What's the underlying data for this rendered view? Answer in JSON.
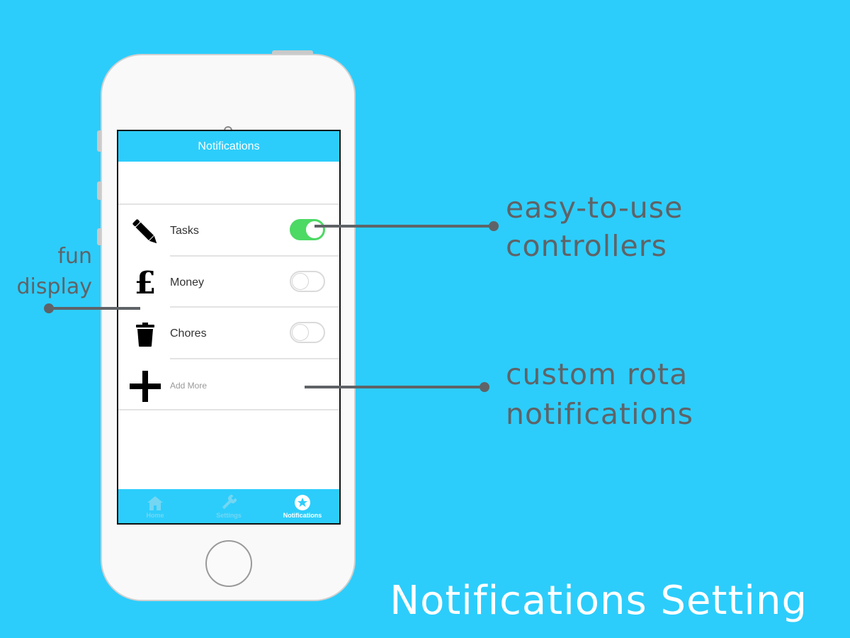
{
  "screen": {
    "nav_title": "Notifications",
    "rows": [
      {
        "label": "Tasks",
        "icon": "pencil-icon",
        "toggle_on": true
      },
      {
        "label": "Money",
        "icon": "pound-icon",
        "toggle_on": false
      },
      {
        "label": "Chores",
        "icon": "trash-icon",
        "toggle_on": false
      },
      {
        "label": "Add More",
        "icon": "plus-icon"
      }
    ],
    "tabs": [
      {
        "label": "Home",
        "icon": "home-icon",
        "active": false
      },
      {
        "label": "Settings",
        "icon": "wrench-icon",
        "active": false
      },
      {
        "label": "Notifications",
        "icon": "star-icon",
        "active": true
      }
    ],
    "pound_glyph": "£"
  },
  "callouts": {
    "controllers_line1": "easy-to-use",
    "controllers_line2": "controllers",
    "rota_line1": "custom rota",
    "rota_line2": "notifications",
    "fun_line1": "fun",
    "fun_line2": "display"
  },
  "page_title": "Notifications Setting",
  "colors": {
    "background": "#2ccdfb",
    "toggle_on": "#4cd964",
    "callout": "#5f6367"
  }
}
